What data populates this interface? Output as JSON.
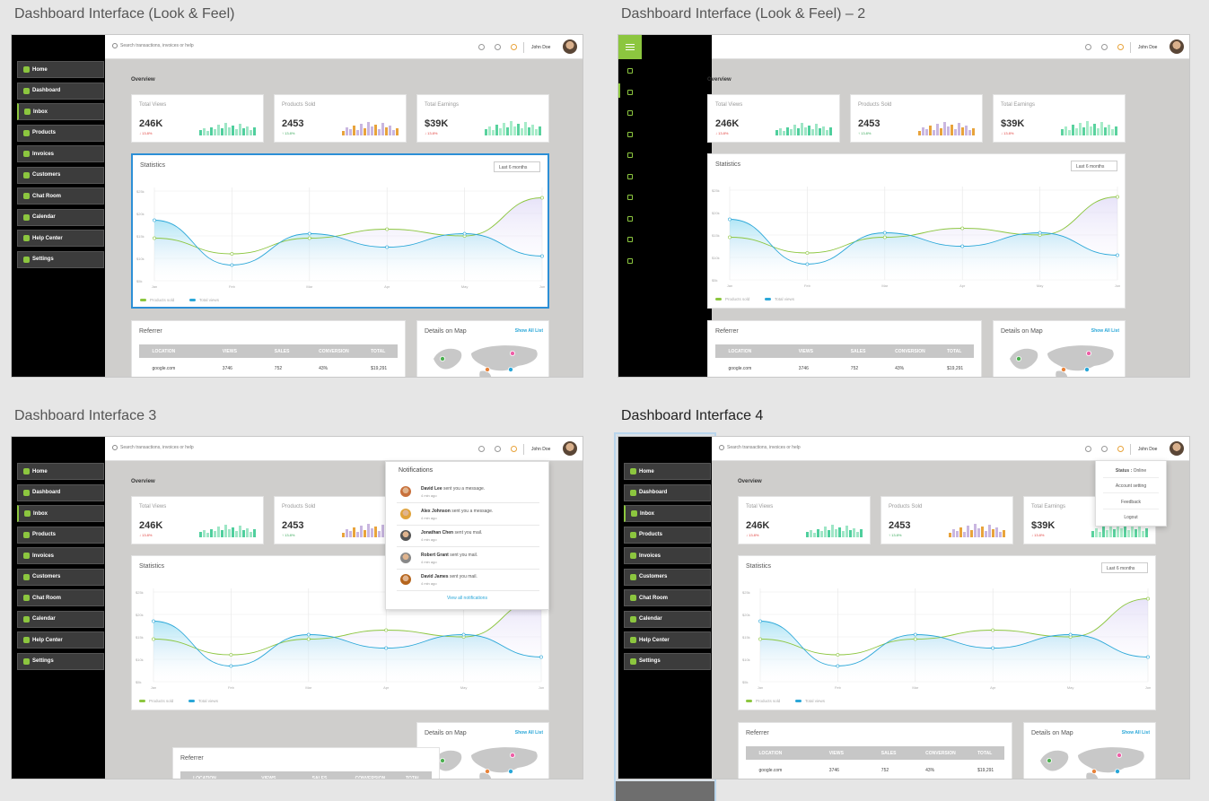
{
  "titles": {
    "f1": "Dashboard Interface (Look & Feel)",
    "f2": "Dashboard Interface (Look & Feel) – 2",
    "f3": "Dashboard Interface 3",
    "f4": "Dashboard Interface 4"
  },
  "colors": {
    "accent": "#8cc63f",
    "chart_blue": "#2aa7d8",
    "frame_selected": "#2c8fd6"
  },
  "nav": [
    "Home",
    "Dashboard",
    "Inbox",
    "Products",
    "Invoices",
    "Customers",
    "Chat Room",
    "Calendar",
    "Help Center",
    "Settings"
  ],
  "nav_icons": [
    "home-icon",
    "bar-chart-icon",
    "inbox-icon",
    "flag-icon",
    "invoice-icon",
    "user-icon",
    "chat-icon",
    "calendar-icon",
    "help-icon",
    "gear-icon"
  ],
  "topbar": {
    "search_placeholder": "Search transactions, invoices or help",
    "user": "John Doe"
  },
  "overview": "Overview",
  "cards": [
    {
      "label": "Total Views",
      "value": "246K",
      "change": "↓ 13.8%",
      "trend": "down"
    },
    {
      "label": "Products Sold",
      "value": "2453",
      "change": "↑ 13.8%",
      "trend": "up"
    },
    {
      "label": "Total Earnings",
      "value": "$39K",
      "change": "↓ 13.8%",
      "trend": "down"
    }
  ],
  "stats": {
    "title": "Statistics",
    "period": "Last 6 months"
  },
  "chart_data": {
    "type": "line",
    "title": "Statistics",
    "categories": [
      "Jan",
      "Feb",
      "Mar",
      "Apr",
      "May",
      "Jun"
    ],
    "y_ticks": [
      "$5k",
      "$10k",
      "$15k",
      "$20k",
      "$25k"
    ],
    "series": [
      {
        "name": "Products sold",
        "color": "#8cc63f",
        "values": [
          14.5,
          11,
          14.5,
          16.5,
          15,
          23.5
        ]
      },
      {
        "name": "Total views",
        "color": "#2aa7d8",
        "values": [
          18.5,
          8.5,
          15.5,
          12.5,
          15.5,
          10.5
        ]
      }
    ],
    "legend": "bottom-left",
    "grid": true
  },
  "referrer": {
    "title": "Referrer",
    "columns": [
      "LOCATION",
      "VIEWS",
      "SALES",
      "CONVERSION",
      "TOTAL"
    ],
    "rows": [
      [
        "google.com",
        "3746",
        "752",
        "43%",
        "$19,291"
      ]
    ]
  },
  "map": {
    "title": "Details on Map",
    "link": "Show All List"
  },
  "notifications": {
    "title": "Notifications",
    "items": [
      {
        "name": "David Lee",
        "text": "sent you a message.",
        "time": "4 min ago"
      },
      {
        "name": "Alex Johnson",
        "text": "sent you a message.",
        "time": "4 min ago"
      },
      {
        "name": "Jonathan Chen",
        "text": "sent you mail.",
        "time": "4 min ago"
      },
      {
        "name": "Robert Grant",
        "text": "sent you mail.",
        "time": "4 min ago"
      },
      {
        "name": "David James",
        "text": "sent you mail.",
        "time": "4 min ago"
      }
    ],
    "view_all": "View all notifications"
  },
  "user_menu": {
    "status_label": "Status :",
    "status_value": "Online",
    "items": [
      "Account setting",
      "Feedback",
      "Logout"
    ]
  },
  "bar_values": [
    [
      6,
      8,
      5,
      9,
      7,
      12,
      8,
      14,
      9,
      11,
      7,
      13,
      8,
      10,
      6,
      9
    ],
    [
      5,
      9,
      7,
      11,
      6,
      13,
      8,
      15,
      10,
      12,
      7,
      14,
      9,
      11,
      6,
      8
    ],
    [
      7,
      10,
      6,
      12,
      8,
      14,
      9,
      16,
      10,
      13,
      8,
      15,
      9,
      12,
      7,
      10
    ]
  ]
}
